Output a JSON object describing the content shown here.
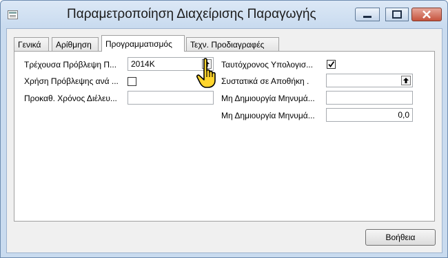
{
  "window": {
    "title": "Παραμετροποίηση Διαχείρισης Παραγωγής"
  },
  "tabs": [
    {
      "label": "Γενικά"
    },
    {
      "label": "Αρίθμηση"
    },
    {
      "label": "Προγραμματισμός"
    },
    {
      "label": "Τεχν. Προδιαγραφές"
    }
  ],
  "active_tab": "Προγραμματισμός",
  "left_fields": {
    "current_forecast": {
      "label": "Τρέχουσα Πρόβλεψη Π...",
      "value": "2014K"
    },
    "use_forecast_by": {
      "label": "Χρήση Πρόβλεψης ανά ...",
      "checked": false
    },
    "default_safety_time": {
      "label": "Προκαθ. Χρόνος Διέλευ...",
      "value": ""
    }
  },
  "right_fields": {
    "simultaneous_calc": {
      "label": "Ταυτόχρονος Υπολογισ...",
      "checked": true
    },
    "components_at_location": {
      "label": "Συστατικά σε Αποθήκη .",
      "value": ""
    },
    "no_create_messages_1": {
      "label": "Μη Δημιουργία Μηνυμά...",
      "value": ""
    },
    "no_create_messages_2": {
      "label": "Μη Δημιουργία Μηνυμά...",
      "value": "0,0"
    }
  },
  "buttons": {
    "help": "Βοήθεια"
  }
}
